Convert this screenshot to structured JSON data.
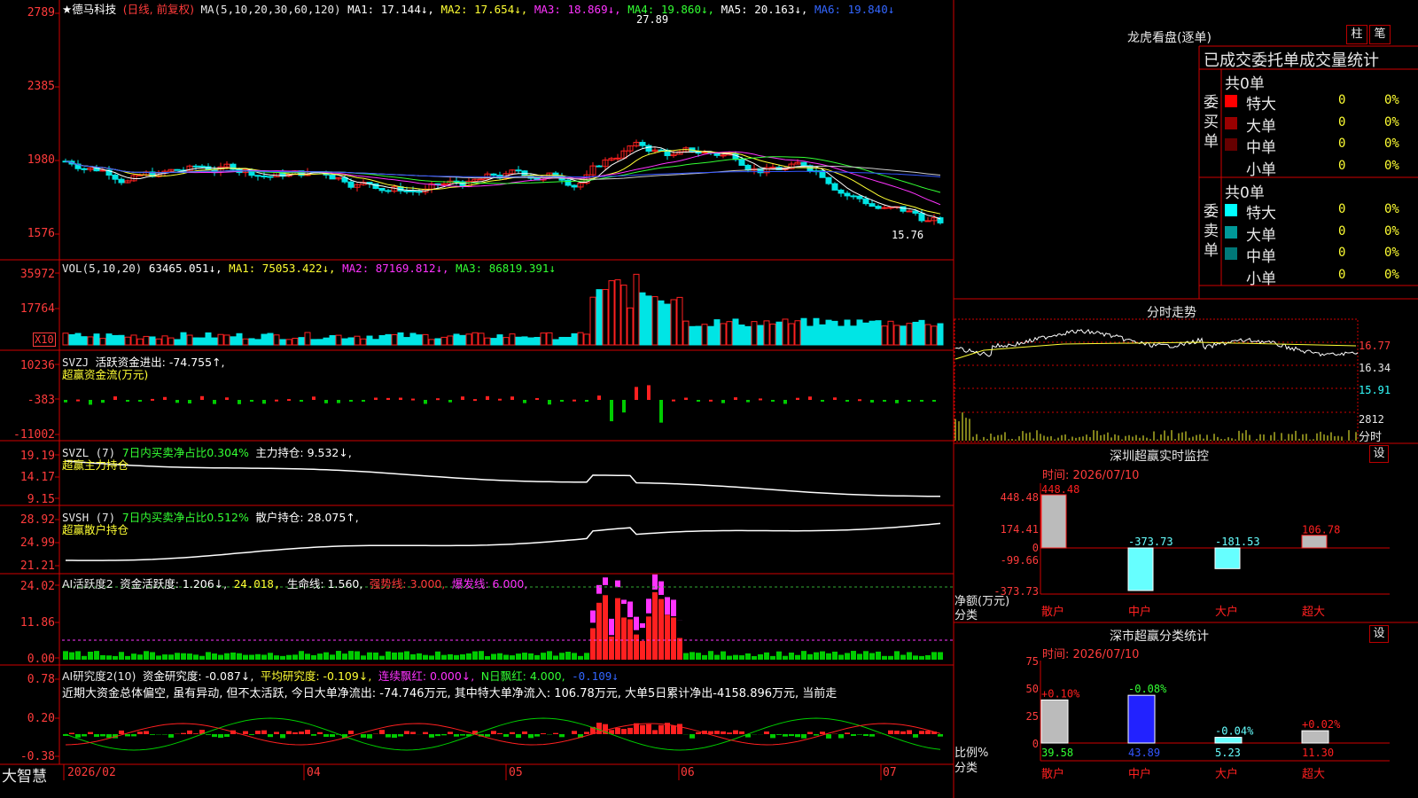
{
  "colors": {
    "up": "#ff2020",
    "down": "#00e5e5",
    "grid": "#8b0000",
    "frame": "#d00000"
  },
  "main": {
    "stock_name": "★德马科技",
    "period": "(日线, 前复权)",
    "ma_label": "MA(5,10,20,30,60,120)",
    "ma1": "MA1: 17.144↓,",
    "ma2": "MA2: 17.654↓,",
    "ma3": "MA3: 18.869↓,",
    "ma4": "MA4: 19.860↓,",
    "ma5": "MA5: 20.163↓,",
    "ma6": "MA6: 19.840↓",
    "y_ticks": [
      "2789",
      "2385",
      "1980",
      "1576"
    ],
    "high_label": "27.89",
    "low_label": "15.76"
  },
  "vol": {
    "header": "VOL(5,10,20)",
    "value": "63465.051↓,",
    "ma1": "MA1: 75053.422↓,",
    "ma2": "MA2: 87169.812↓,",
    "ma3": "MA3: 86819.391↓",
    "y_ticks": [
      "35972",
      "17764"
    ],
    "unit": "X10"
  },
  "svzj": {
    "header": "SVZJ",
    "label": "活跃资金进出: -74.755↑,",
    "subtitle": "超赢资金流(万元)",
    "y_ticks": [
      "10236",
      "-383",
      "-11002"
    ]
  },
  "svzl": {
    "header": "SVZL (7)",
    "label1": "7日内买卖净占比0.304%",
    "label2": "主力持仓: 9.532↓,",
    "subtitle": "超赢主力持仓",
    "y_ticks": [
      "19.19",
      "14.17",
      "9.15"
    ]
  },
  "svsh": {
    "header": "SVSH (7)",
    "label1": "7日内买卖净占比0.512%",
    "label2": "散户持仓: 28.075↑,",
    "subtitle": "超赢散户持仓",
    "y_ticks": [
      "28.92",
      "24.99",
      "21.21"
    ]
  },
  "ai1": {
    "header": "AI活跃度2",
    "label1": "资金活跃度: 1.206↓,",
    "label2": "24.018,",
    "label3": "生命线: 1.560,",
    "label4": "强势线: 3.000,",
    "label5": "爆发线: 6.000,",
    "y_ticks": [
      "24.02",
      "11.86",
      "0.00"
    ]
  },
  "ai2": {
    "header": "AI研究度2(10)",
    "label1": "资金研究度: -0.087↓,",
    "label2": "平均研究度: -0.109↓,",
    "label3": "连续飘红: 0.000↓,",
    "label4": "N日飘红: 4.000,",
    "label5": "-0.109↓",
    "commentary": "近期大资金总体偏空, 虽有异动, 但不太活跃, 今日大单净流出: -74.746万元, 其中特大单净流入: 106.78万元, 大单5日累计净出-4158.896万元, 当前走",
    "y_ticks": [
      "0.78",
      "0.20",
      "-0.38"
    ]
  },
  "x_axis": {
    "labels": [
      "2026/02",
      "04",
      "05",
      "06",
      "07"
    ],
    "brand": "大智慧"
  },
  "dragon": {
    "title": "龙虎看盘(逐单)",
    "btn1": "柱",
    "btn2": "笔",
    "subtitle": "已成交委托单成交量统计",
    "buy_label": "委买单",
    "sell_label": "委卖单",
    "buy_total": "共0单",
    "sell_total": "共0单",
    "buy_rows": [
      {
        "name": "特大",
        "count": "0",
        "pct": "0%",
        "color": "#ff0000"
      },
      {
        "name": "大单",
        "count": "0",
        "pct": "0%",
        "color": "#990000"
      },
      {
        "name": "中单",
        "count": "0",
        "pct": "0%",
        "color": "#660000"
      },
      {
        "name": "小单",
        "count": "0",
        "pct": "0%",
        "color": ""
      }
    ],
    "sell_rows": [
      {
        "name": "特大",
        "count": "0",
        "pct": "0%",
        "color": "#00ffff"
      },
      {
        "name": "大单",
        "count": "0",
        "pct": "0%",
        "color": "#009999"
      },
      {
        "name": "中单",
        "count": "0",
        "pct": "0%",
        "color": "#007777"
      },
      {
        "name": "小单",
        "count": "0",
        "pct": "0%",
        "color": ""
      }
    ]
  },
  "intraday": {
    "title": "分时走势",
    "p1": "16.77",
    "p2": "16.34",
    "p3": "15.91",
    "vol": "2812",
    "vol_label": "分时"
  },
  "monitor": {
    "title": "深圳超赢实时监控",
    "set": "设",
    "time": "时间: 2026/07/10",
    "y_ticks": [
      "448.48",
      "174.41",
      "0",
      "-99.66",
      "-373.73"
    ],
    "ylabel": "净额(万元)",
    "xlabel": "分类",
    "categories": [
      "散户",
      "中户",
      "大户",
      "超大"
    ]
  },
  "classify": {
    "title": "深市超赢分类统计",
    "set": "设",
    "time": "时间: 2026/07/10",
    "y_ticks": [
      "75",
      "50",
      "25",
      "0"
    ],
    "ylabel": "比例%",
    "xlabel": "分类",
    "categories": [
      "散户",
      "中户",
      "大户",
      "超大"
    ]
  },
  "chart_data": [
    {
      "type": "bar",
      "title": "深圳超赢实时监控",
      "categories": [
        "散户",
        "中户",
        "大户",
        "超大"
      ],
      "values": [
        448.48,
        -373.73,
        -181.53,
        106.78
      ],
      "value_labels": [
        "448.48",
        "-373.73",
        "-181.53",
        "106.78"
      ],
      "ylabel": "净额(万元)",
      "ylim": [
        -373.73,
        448.48
      ]
    },
    {
      "type": "bar",
      "title": "深市超赢分类统计",
      "categories": [
        "散户",
        "中户",
        "大户",
        "超大"
      ],
      "values": [
        39.58,
        43.89,
        5.23,
        11.3
      ],
      "value_labels": [
        "39.58",
        "43.89",
        "5.23",
        "11.30"
      ],
      "changes": [
        "+0.10%",
        "-0.08%",
        "-0.04%",
        "+0.02%"
      ],
      "ylabel": "比例%",
      "ylim": [
        0,
        75
      ]
    }
  ]
}
